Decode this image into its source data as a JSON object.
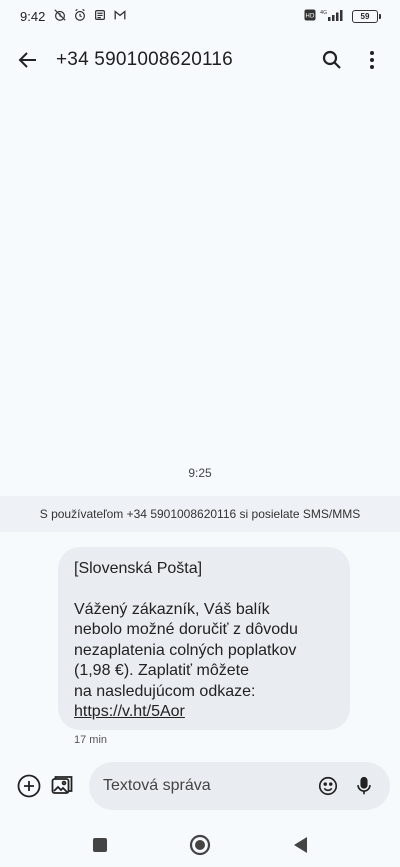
{
  "status_bar": {
    "time": "9:42",
    "battery": "59",
    "network": "4G"
  },
  "app_bar": {
    "title": "+34 5901008620116",
    "icons": [
      "back-arrow-icon",
      "search-icon",
      "more-vert-icon"
    ]
  },
  "conversation": {
    "timestamp": "9:25",
    "banner": "S používateľom +34 5901008620116 si posielate SMS/MMS",
    "message": {
      "line1": "[Slovenská Pošta]",
      "line2": "Vážený zákazník, Váš balík",
      "line3": "nebolo možné doručiť z dôvodu",
      "line4": "nezaplatenia colných poplatkov",
      "line5": "(1,98 €). Zaplatiť môžete",
      "line6": "na nasledujúcom odkaze:",
      "link": "https://v.ht/5Aor",
      "time": "17 min"
    }
  },
  "compose": {
    "placeholder": "Textová správa"
  }
}
